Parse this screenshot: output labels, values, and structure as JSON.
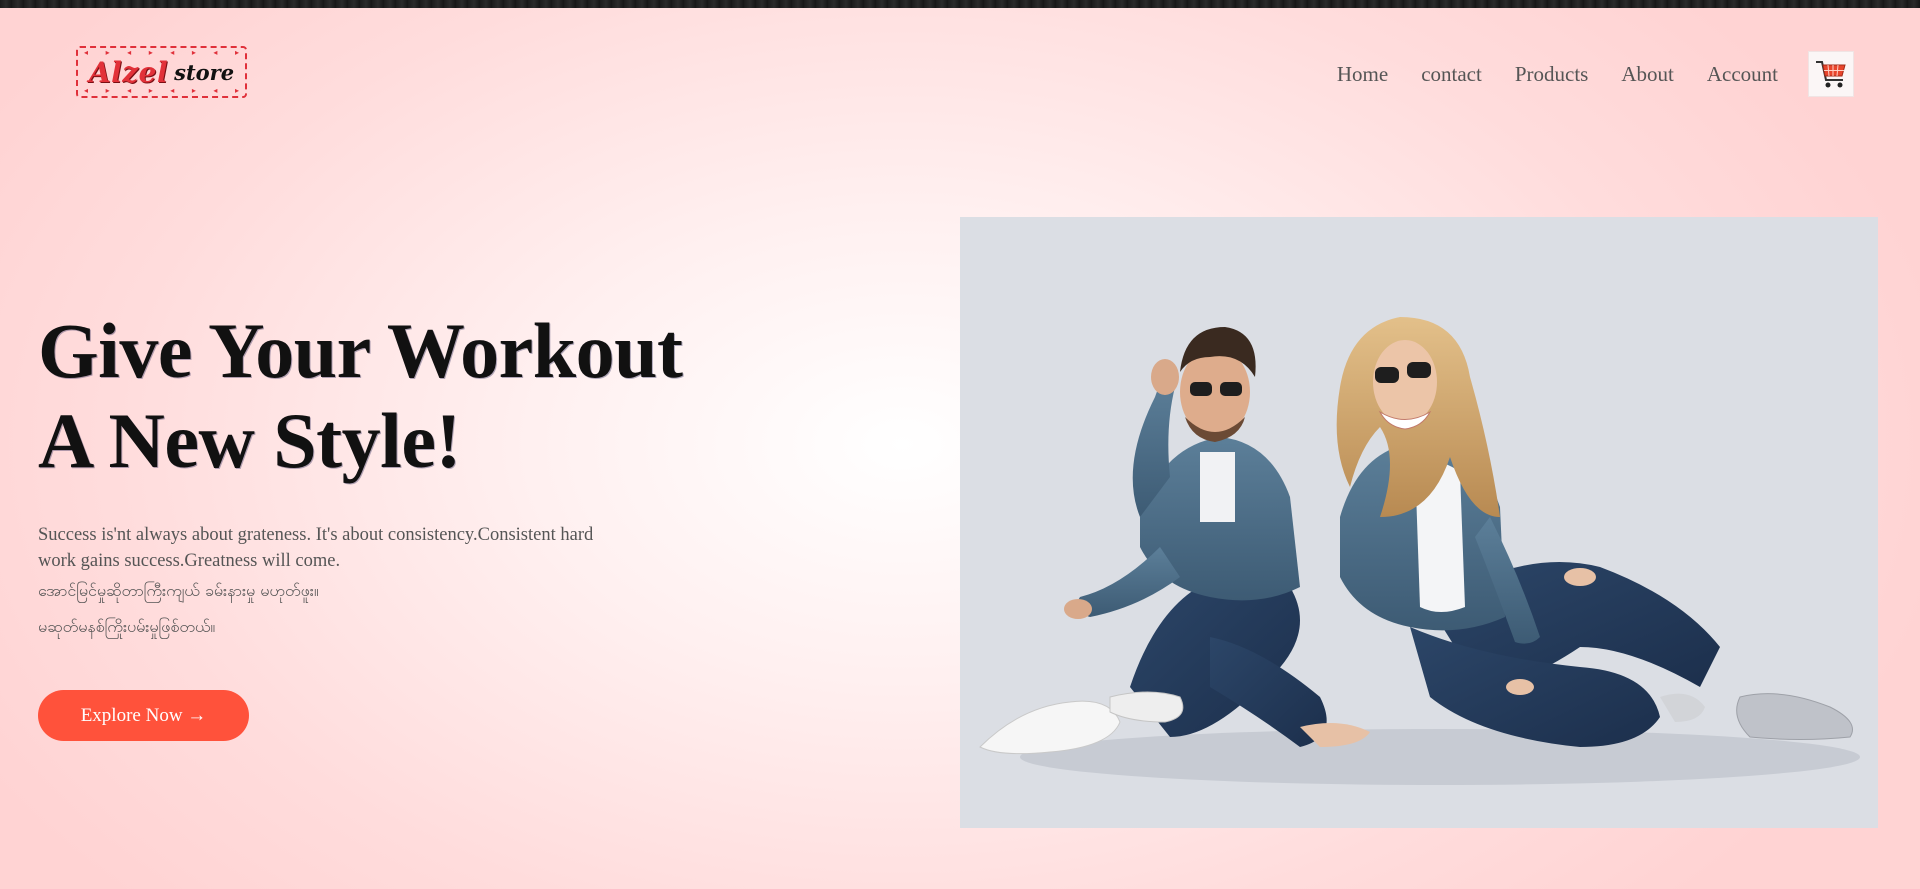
{
  "logo": {
    "brand": "Alzel",
    "suffix": "store"
  },
  "nav": {
    "items": [
      "Home",
      "contact",
      "Products",
      "About",
      "Account"
    ],
    "cart_icon": "shopping-cart-icon"
  },
  "hero": {
    "title_line1": "Give Your Workout",
    "title_line2": "A New Style!",
    "description": "Success is'nt always about grateness. It's about consistency.Consistent hard work gains success.Greatness will come.",
    "description_mm_line1": "အောင်မြင်မှုဆိုတာကြီးကျယ် ခမ်းနားမှု မဟုတ်ဖူး။",
    "description_mm_line2": "မဆုတ်မနစ်ကြိုးပမ်းမှုဖြစ်တယ်။",
    "button_label": "Explore Now →"
  },
  "colors": {
    "accent": "#ff523b",
    "logo_red": "#e23139",
    "image_bg": "#dbdee4"
  }
}
